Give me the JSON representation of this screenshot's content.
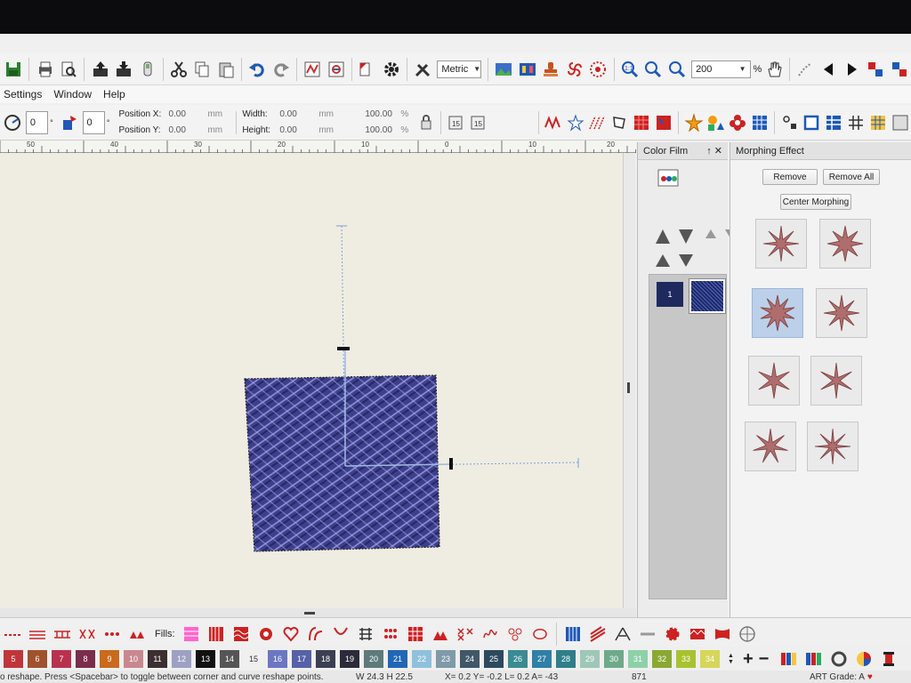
{
  "toolbar_top": {
    "units_select": "Metric",
    "zoom_value": "200",
    "zoom_unit": "%"
  },
  "menu": {
    "items": [
      "Settings",
      "Window",
      "Help"
    ]
  },
  "props": {
    "angle_value": "0",
    "rotate_value": "0",
    "position_x_label": "Position X:",
    "position_x_value": "0.00",
    "position_y_label": "Position Y:",
    "position_y_value": "0.00",
    "unit_mm": "mm",
    "width_label": "Width:",
    "width_value": "0.00",
    "height_label": "Height:",
    "height_value": "0.00",
    "width_pct": "100.00",
    "height_pct": "100.00",
    "pct": "%",
    "step_a": "15",
    "step_b": "15"
  },
  "ruler": {
    "labels": [
      "50",
      "40",
      "30",
      "20",
      "10",
      "0",
      "10",
      "20"
    ]
  },
  "color_film": {
    "title": "Color Film",
    "pin": "↑",
    "close": "✕",
    "order_label": "123",
    "item_number": "1",
    "item_color": "#1b2a6b"
  },
  "morphing": {
    "title": "Morphing Effect",
    "remove": "Remove",
    "remove_all": "Remove All",
    "center": "Center Morphing",
    "star_color": "#b06d6d"
  },
  "bottom": {
    "fills_label": "Fills:",
    "plus": "+",
    "minus": "−"
  },
  "palette": {
    "colors": [
      {
        "n": "5",
        "c": "#c0363a"
      },
      {
        "n": "6",
        "c": "#a0522d"
      },
      {
        "n": "7",
        "c": "#b8324f"
      },
      {
        "n": "8",
        "c": "#7a2e4b"
      },
      {
        "n": "9",
        "c": "#c96a1e"
      },
      {
        "n": "10",
        "c": "#c98890"
      },
      {
        "n": "11",
        "c": "#3b2f2f"
      },
      {
        "n": "12",
        "c": "#9da0c4"
      },
      {
        "n": "13",
        "c": "#111111"
      },
      {
        "n": "14",
        "c": "#555555"
      },
      {
        "n": "15",
        "c": "#f0f0f0"
      },
      {
        "n": "16",
        "c": "#6a77c2"
      },
      {
        "n": "17",
        "c": "#5661a8"
      },
      {
        "n": "18",
        "c": "#3c3f52"
      },
      {
        "n": "19",
        "c": "#2b2b3b"
      },
      {
        "n": "20",
        "c": "#5e7a7a"
      },
      {
        "n": "21",
        "c": "#2167b5"
      },
      {
        "n": "22",
        "c": "#8fc1dd"
      },
      {
        "n": "23",
        "c": "#7f9aa8"
      },
      {
        "n": "24",
        "c": "#405868"
      },
      {
        "n": "25",
        "c": "#2c4a5e"
      },
      {
        "n": "26",
        "c": "#3a8b93"
      },
      {
        "n": "27",
        "c": "#2f7fa8"
      },
      {
        "n": "28",
        "c": "#2f7f8a"
      },
      {
        "n": "29",
        "c": "#9ec7b8"
      },
      {
        "n": "30",
        "c": "#6eaa8a"
      },
      {
        "n": "31",
        "c": "#8fd0a8"
      },
      {
        "n": "32",
        "c": "#8aa832"
      },
      {
        "n": "33",
        "c": "#a8c22f"
      },
      {
        "n": "34",
        "c": "#d6d65a"
      }
    ]
  },
  "status": {
    "hint": "o reshape. Press <Spacebar> to toggle between corner and curve reshape points.",
    "size": "W  24.3 H  22.5",
    "coords": "X=    0.2 Y=   -0.2 L=    0.2 A= -43",
    "stitches": "871",
    "art_grade": "ART Grade: A"
  }
}
